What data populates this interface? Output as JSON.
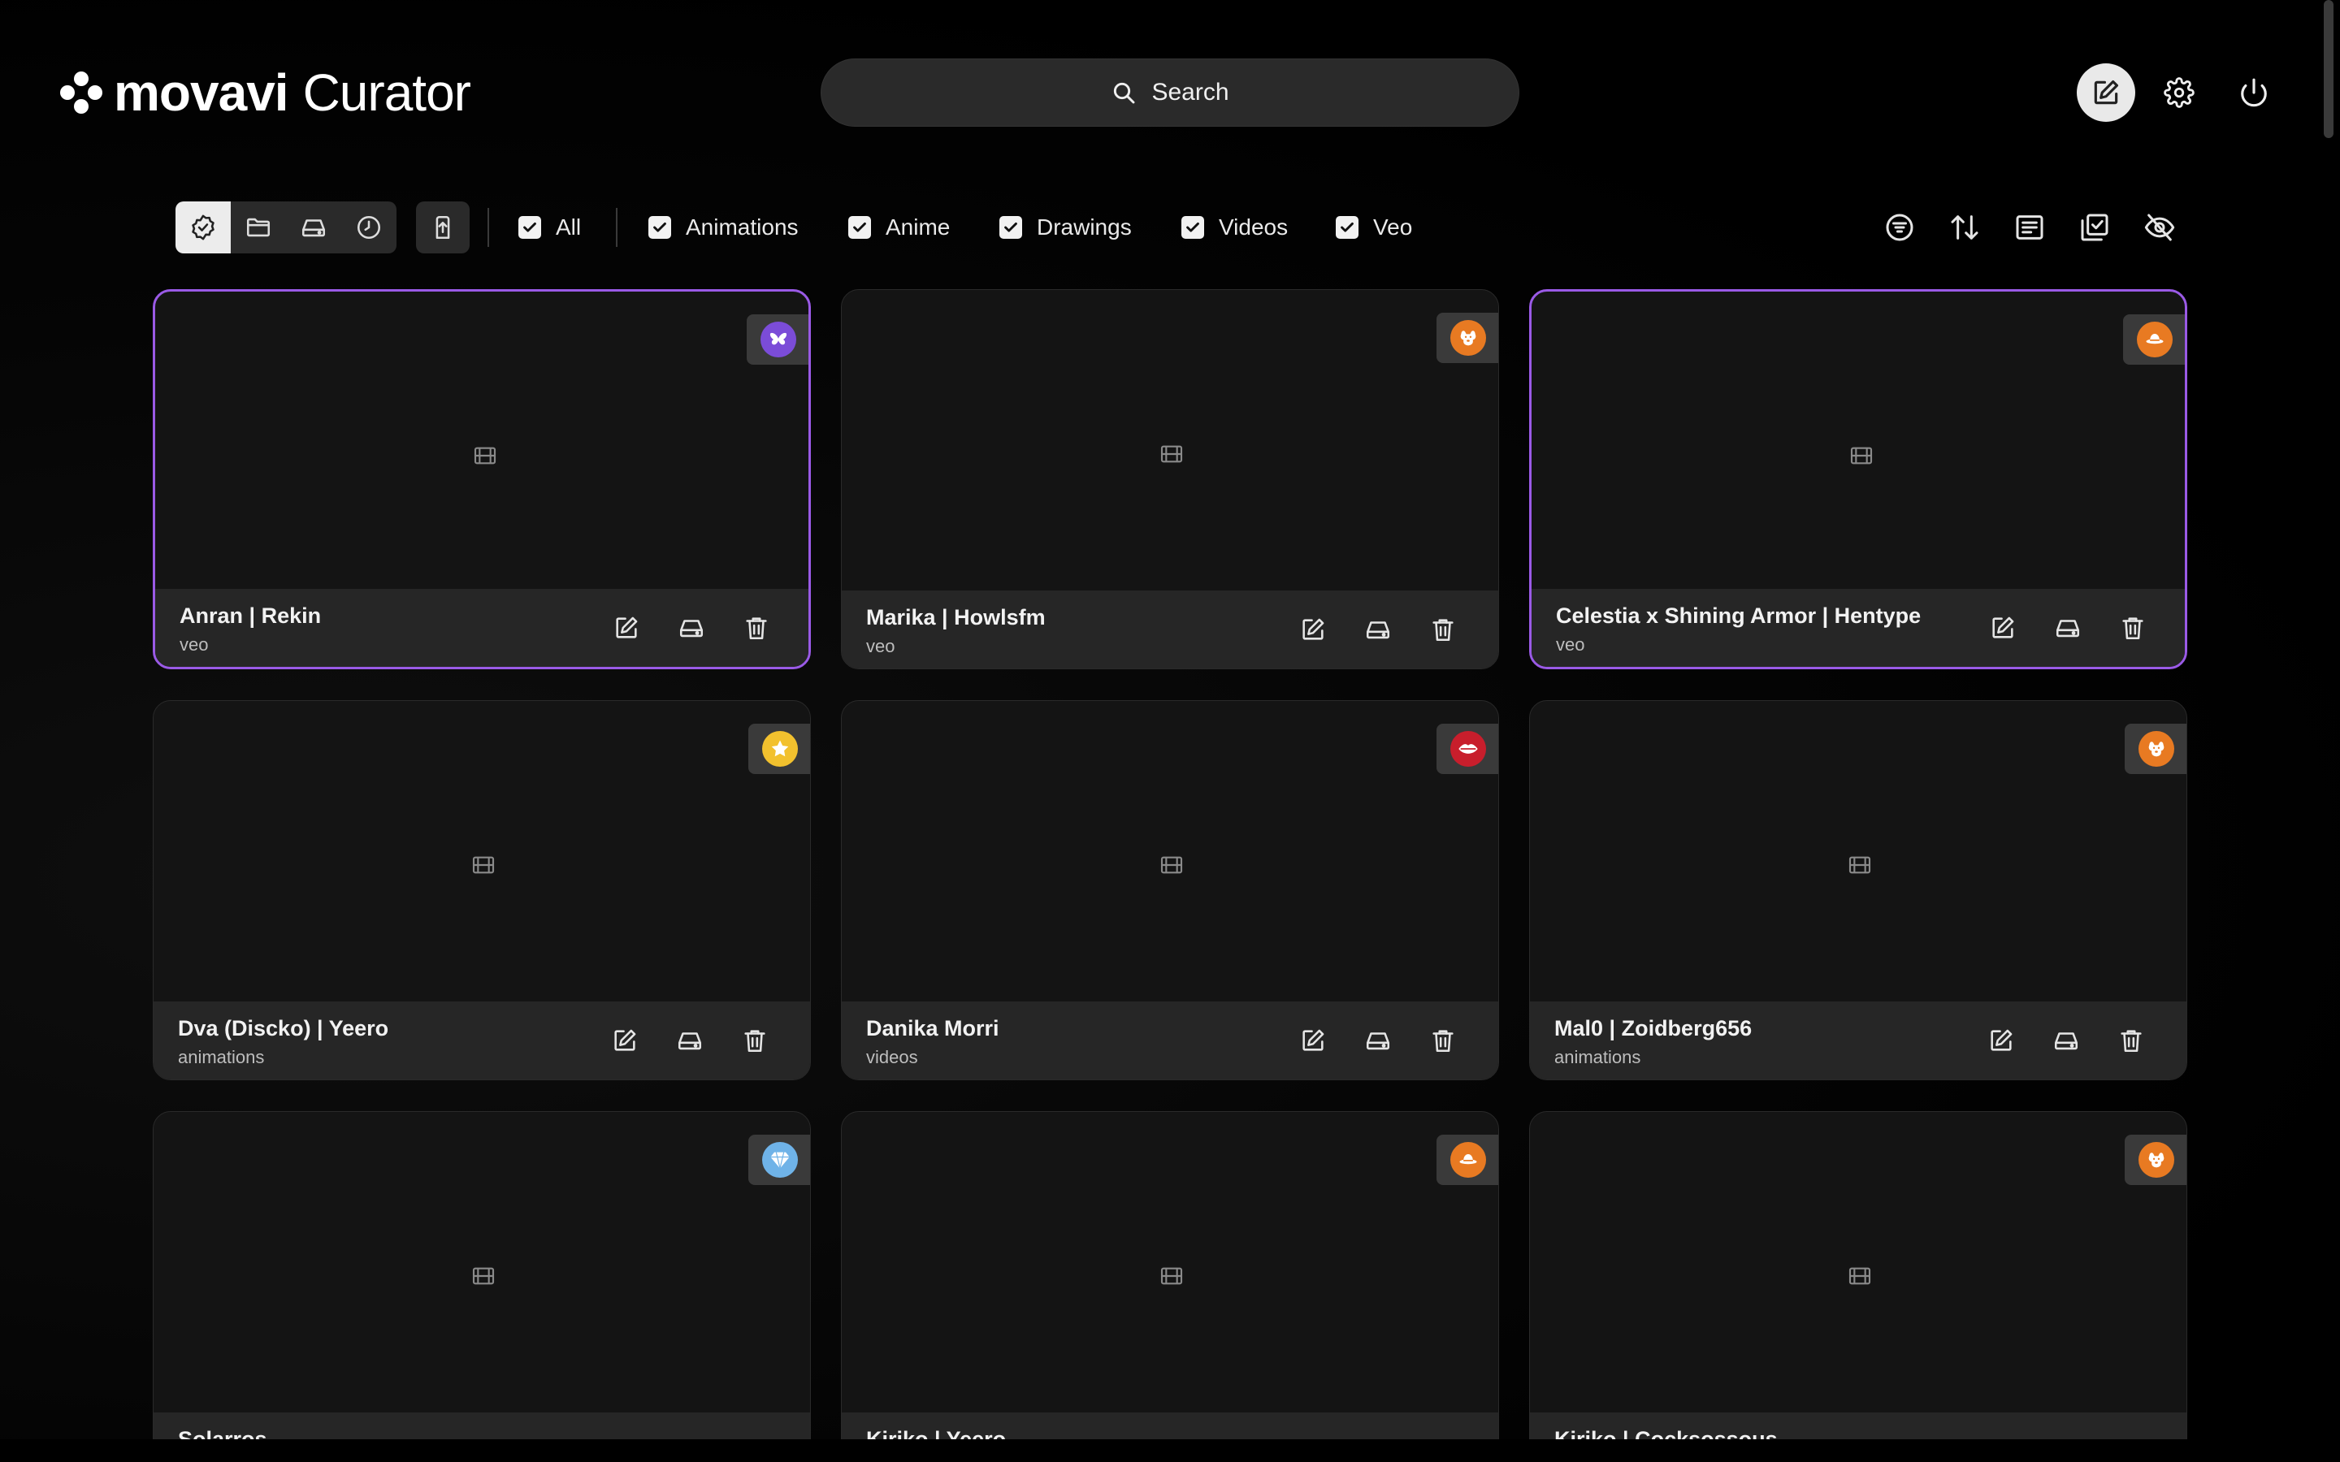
{
  "app": {
    "brand": "movavi",
    "product": "Curator"
  },
  "search": {
    "label": "Search"
  },
  "header_actions": {
    "edit_icon": "edit-square-icon",
    "settings_icon": "gear-icon",
    "power_icon": "power-icon"
  },
  "view_modes": [
    {
      "name": "verified",
      "icon": "badge-check-icon",
      "active": true
    },
    {
      "name": "folder",
      "icon": "folder-icon",
      "active": false
    },
    {
      "name": "drive",
      "icon": "drive-icon",
      "active": false
    },
    {
      "name": "recent",
      "icon": "clock-icon",
      "active": false
    }
  ],
  "filters": [
    {
      "label": "All",
      "checked": true
    },
    {
      "label": "Animations",
      "checked": true
    },
    {
      "label": "Anime",
      "checked": true
    },
    {
      "label": "Drawings",
      "checked": true
    },
    {
      "label": "Videos",
      "checked": true
    },
    {
      "label": "Veo",
      "checked": true
    }
  ],
  "tools": [
    "filter-list-icon",
    "sort-icon",
    "list-view-icon",
    "select-multiple-icon",
    "hide-icon"
  ],
  "colors": {
    "selected_border": "#9a5ae6",
    "badge_purple": "#7b4cd8",
    "badge_orange": "#e87a22",
    "badge_yellow": "#f2c12e",
    "badge_red": "#c81e2c",
    "badge_blue": "#6fb3e8"
  },
  "cards": [
    {
      "title": "Anran | Rekin",
      "category": "veo",
      "badge": "butterfly-icon",
      "badge_color": "#7b4cd8",
      "selected": true
    },
    {
      "title": "Marika | Howlsfm",
      "category": "veo",
      "badge": "dog-icon",
      "badge_color": "#e87a22",
      "selected": false
    },
    {
      "title": "Celestia x Shining Armor | Hentype",
      "category": "veo",
      "badge": "hat-icon",
      "badge_color": "#e87a22",
      "selected": true
    },
    {
      "title": "Dva (Discko) | Yeero",
      "category": "animations",
      "badge": "star-icon",
      "badge_color": "#f2c12e",
      "selected": false
    },
    {
      "title": "Danika Morri",
      "category": "videos",
      "badge": "lips-icon",
      "badge_color": "#c81e2c",
      "selected": false
    },
    {
      "title": "Mal0 | Zoidberg656",
      "category": "animations",
      "badge": "dog-icon",
      "badge_color": "#e87a22",
      "selected": false
    },
    {
      "title": "Solarros",
      "category": "",
      "badge": "diamond-icon",
      "badge_color": "#6fb3e8",
      "selected": false
    },
    {
      "title": "Kiriko | Yeero",
      "category": "",
      "badge": "hat-icon",
      "badge_color": "#e87a22",
      "selected": false
    },
    {
      "title": "Kiriko | Cocksossous",
      "category": "",
      "badge": "dog-icon",
      "badge_color": "#e87a22",
      "selected": false
    }
  ]
}
